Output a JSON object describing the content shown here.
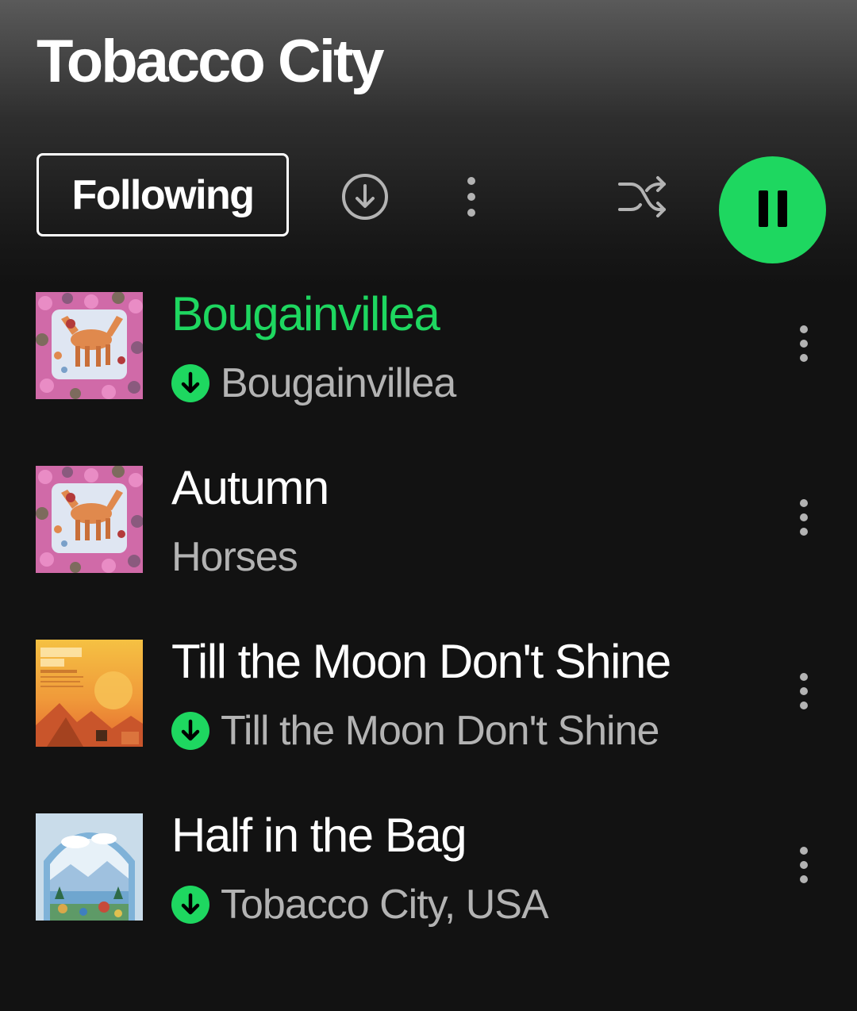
{
  "header": {
    "title": "Tobacco City"
  },
  "controls": {
    "follow_label": "Following",
    "downloaded": false,
    "shuffle": false,
    "playing": true
  },
  "colors": {
    "accent": "#1ed760",
    "text_primary": "#ffffff",
    "text_secondary": "#b3b3b3",
    "background": "#121212"
  },
  "icons": {
    "download": "download-circle-icon",
    "more": "more-vertical-icon",
    "shuffle": "shuffle-icon",
    "pause": "pause-icon",
    "downloaded_badge": "downloaded-badge-icon"
  },
  "tracks": [
    {
      "title": "Bougainvillea",
      "subtitle": "Bougainvillea",
      "downloaded": true,
      "active": true,
      "cover": "horses-album-cover"
    },
    {
      "title": "Autumn",
      "subtitle": "Horses",
      "downloaded": false,
      "active": false,
      "cover": "horses-album-cover"
    },
    {
      "title": "Till the Moon Don't Shine",
      "subtitle": "Till the Moon Don't Shine",
      "downloaded": true,
      "active": false,
      "cover": "lagniappe-session-cover"
    },
    {
      "title": "Half in the Bag",
      "subtitle": "Tobacco City, USA",
      "downloaded": true,
      "active": false,
      "cover": "tobacco-city-usa-cover"
    }
  ]
}
